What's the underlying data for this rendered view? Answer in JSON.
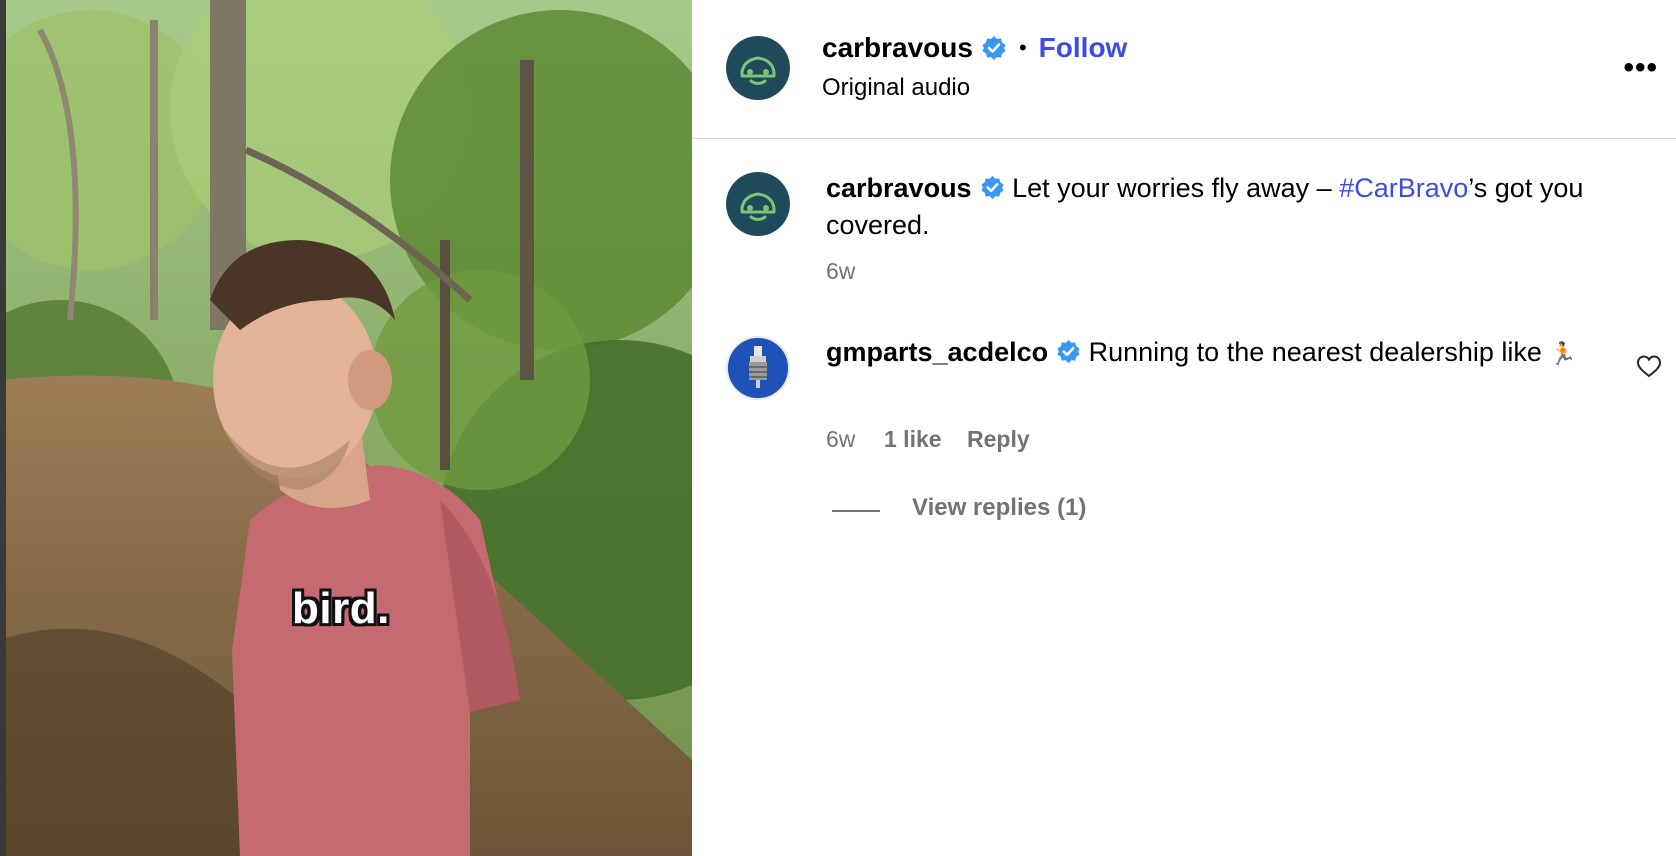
{
  "video": {
    "caption": "bird."
  },
  "header": {
    "username": "carbravous",
    "separator": "•",
    "follow_label": "Follow",
    "audio_label": "Original audio",
    "more_icon": "more-options-icon",
    "more_glyph": "•••"
  },
  "post_caption": {
    "username": "carbravous",
    "text_before": " Let your worries fly away – ",
    "hashtag": "#CarBravo",
    "text_after": "’s got you covered.",
    "time": "6w"
  },
  "comments": [
    {
      "username": "gmparts_acdelco",
      "text": " Running to the nearest dealership like ",
      "emoji": "🏃",
      "time": "6w",
      "likes": "1 like",
      "reply_label": "Reply",
      "view_replies": "View replies (1)"
    }
  ],
  "colors": {
    "accent": "#3d4bec",
    "verified": "#3897f0",
    "muted": "#737373",
    "avatar_bg": "#1f4a5b"
  }
}
